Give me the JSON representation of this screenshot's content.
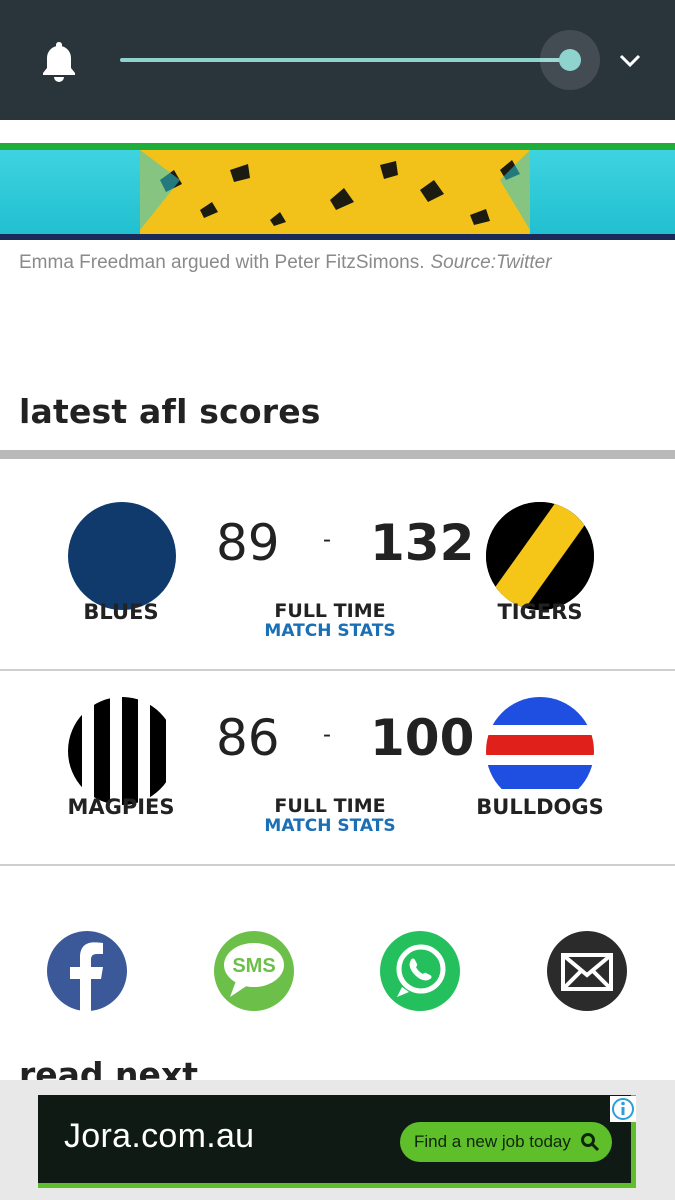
{
  "player": {
    "progress": 0.95
  },
  "article": {
    "caption": "Emma Freedman argued with Peter FitzSimons.",
    "caption_source": "Source:Twitter"
  },
  "scores": {
    "title": "latest afl scores",
    "matches": [
      {
        "home": {
          "name": "BLUES",
          "score": "89",
          "colors": [
            "#0f3a6b"
          ]
        },
        "away": {
          "name": "TIGERS",
          "score": "132",
          "colors": [
            "#f5c518",
            "#000000"
          ]
        },
        "separator": "-",
        "status": "FULL TIME",
        "stats_label": "MATCH STATS"
      },
      {
        "home": {
          "name": "MAGPIES",
          "score": "86",
          "colors": [
            "#000000",
            "#ffffff"
          ]
        },
        "away": {
          "name": "BULLDOGS",
          "score": "100",
          "colors": [
            "#1f4fe0",
            "#e0201b",
            "#ffffff"
          ]
        },
        "separator": "-",
        "status": "FULL TIME",
        "stats_label": "MATCH STATS"
      }
    ]
  },
  "share": {
    "buttons": [
      {
        "icon": "facebook-icon",
        "color": "#3b5998"
      },
      {
        "icon": "sms-icon",
        "label": "SMS",
        "color": "#6cc04a"
      },
      {
        "icon": "whatsapp-icon",
        "color": "#25c05e"
      },
      {
        "icon": "email-icon",
        "color": "#2b2b2b"
      }
    ]
  },
  "read_next": {
    "title": "read next"
  },
  "ad": {
    "brand": "Jora.com.au",
    "cta": "Find a new job today",
    "accent": "#5fbf2a"
  }
}
